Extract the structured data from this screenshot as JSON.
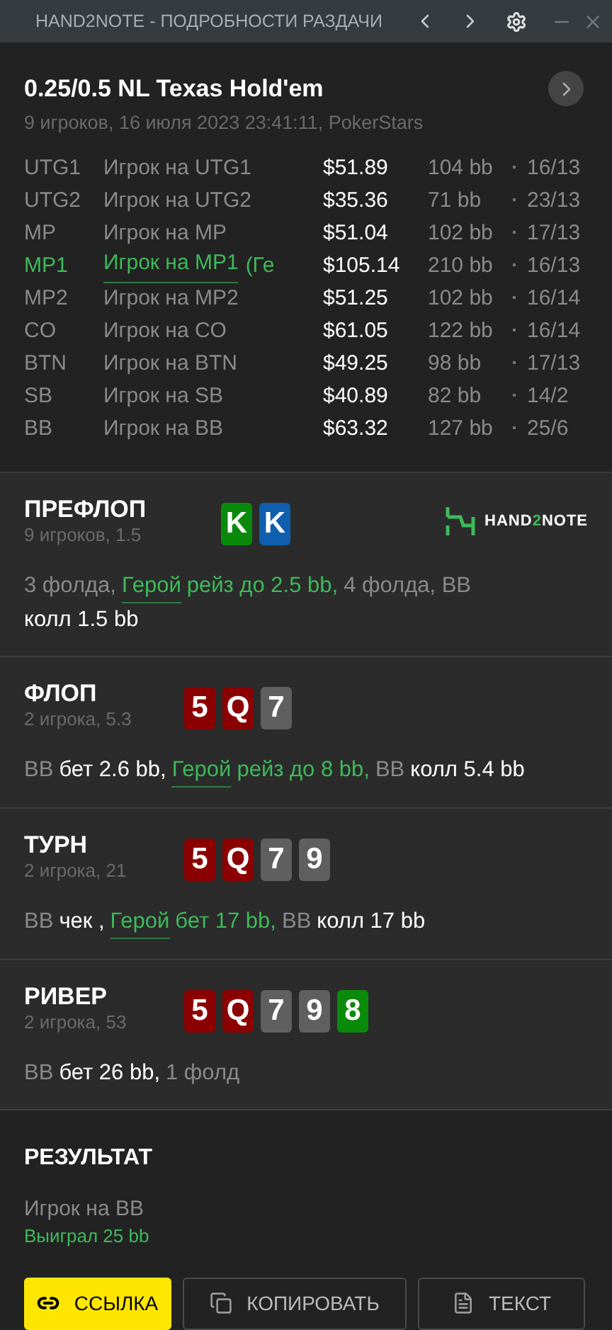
{
  "window": {
    "title": "HAND2NOTE - ПОДРОБНОСТИ РАЗДАЧИ"
  },
  "header": {
    "title": "0.25/0.5 NL Texas Hold'em",
    "subtitle": "9 игроков, 16 июля 2023 23:41:11, PokerStars"
  },
  "players": [
    {
      "position": "UTG1",
      "name": "Игрок на UTG1",
      "stack": "$51.89",
      "bb": "104 bb",
      "stats": "16/13",
      "hero": false
    },
    {
      "position": "UTG2",
      "name": "Игрок на UTG2",
      "stack": "$35.36",
      "bb": "71 bb",
      "stats": "23/13",
      "hero": false
    },
    {
      "position": "MP",
      "name": "Игрок на MP",
      "stack": "$51.04",
      "bb": "102 bb",
      "stats": "17/13",
      "hero": false
    },
    {
      "position": "MP1",
      "name": "Игрок на MP1",
      "note": "(Ге",
      "stack": "$105.14",
      "bb": "210 bb",
      "stats": "16/13",
      "hero": true
    },
    {
      "position": "MP2",
      "name": "Игрок на MP2",
      "stack": "$51.25",
      "bb": "102 bb",
      "stats": "16/14",
      "hero": false
    },
    {
      "position": "CO",
      "name": "Игрок на CO",
      "stack": "$61.05",
      "bb": "122 bb",
      "stats": "16/14",
      "hero": false
    },
    {
      "position": "BTN",
      "name": "Игрок на BTN",
      "stack": "$49.25",
      "bb": "98 bb",
      "stats": "17/13",
      "hero": false
    },
    {
      "position": "SB",
      "name": "Игрок на SB",
      "stack": "$40.89",
      "bb": "82 bb",
      "stats": "14/2",
      "hero": false
    },
    {
      "position": "BB",
      "name": "Игрок на BB",
      "stack": "$63.32",
      "bb": "127 bb",
      "stats": "25/6",
      "hero": false
    }
  ],
  "streets": [
    {
      "name": "ПРЕФЛОП",
      "info": "9 игроков, 1.5",
      "logo": {
        "text_a": "HAND",
        "text_b": "2",
        "text_c": "NOTE"
      },
      "cards": [
        {
          "rank": "K",
          "color": "#0a8a0a"
        },
        {
          "rank": "K",
          "color": "#0f5fae"
        }
      ],
      "actions": [
        {
          "kind": "plain",
          "text": "3 фолда,"
        },
        {
          "kind": "hero_link",
          "text": "Герой"
        },
        {
          "kind": "hero",
          "text": "рейз до 2.5 bb,"
        },
        {
          "kind": "plain",
          "text": "4 фолда, BB"
        },
        {
          "kind": "bold",
          "text": "колл 1.5 bb"
        }
      ]
    },
    {
      "name": "ФЛОП",
      "info": "2 игрока, 5.3",
      "cards": [
        {
          "rank": "5",
          "color": "#8b0000"
        },
        {
          "rank": "Q",
          "color": "#8b0000"
        },
        {
          "rank": "7",
          "color": "#5f5f5f"
        }
      ],
      "actions": [
        {
          "kind": "plain",
          "text": "BB"
        },
        {
          "kind": "bold",
          "text": "бет 2.6 bb,"
        },
        {
          "kind": "hero_link",
          "text": "Герой"
        },
        {
          "kind": "hero",
          "text": "рейз до 8 bb,"
        },
        {
          "kind": "plain",
          "text": "BB"
        },
        {
          "kind": "bold",
          "text": "колл 5.4 bb"
        }
      ]
    },
    {
      "name": "ТУРН",
      "info": "2 игрока, 21",
      "cards": [
        {
          "rank": "5",
          "color": "#8b0000"
        },
        {
          "rank": "Q",
          "color": "#8b0000"
        },
        {
          "rank": "7",
          "color": "#5f5f5f"
        },
        {
          "rank": "9",
          "color": "#5f5f5f"
        }
      ],
      "actions": [
        {
          "kind": "plain",
          "text": "BB"
        },
        {
          "kind": "bold",
          "text": "чек ,"
        },
        {
          "kind": "hero_link",
          "text": "Герой"
        },
        {
          "kind": "hero",
          "text": "бет 17 bb,"
        },
        {
          "kind": "plain",
          "text": "BB"
        },
        {
          "kind": "bold",
          "text": "колл 17 bb"
        }
      ]
    },
    {
      "name": "РИВЕР",
      "info": "2 игрока, 53",
      "cards": [
        {
          "rank": "5",
          "color": "#8b0000"
        },
        {
          "rank": "Q",
          "color": "#8b0000"
        },
        {
          "rank": "7",
          "color": "#5f5f5f"
        },
        {
          "rank": "9",
          "color": "#5f5f5f"
        },
        {
          "rank": "8",
          "color": "#0a8a0a"
        }
      ],
      "actions": [
        {
          "kind": "plain",
          "text": "BB"
        },
        {
          "kind": "bold",
          "text": "бет 26 bb,"
        },
        {
          "kind": "plain",
          "text": "1 фолд"
        }
      ]
    }
  ],
  "result": {
    "title": "РЕЗУЛЬТАТ",
    "player": "Игрок на BB",
    "outcome": "Выиграл 25 bb"
  },
  "buttons": [
    {
      "label": "ССЫЛКА",
      "kind": "link",
      "primary": true
    },
    {
      "label": "КОПИРОВАТЬ",
      "kind": "copy",
      "primary": false
    },
    {
      "label": "ТЕКСТ",
      "kind": "text",
      "primary": false
    }
  ]
}
